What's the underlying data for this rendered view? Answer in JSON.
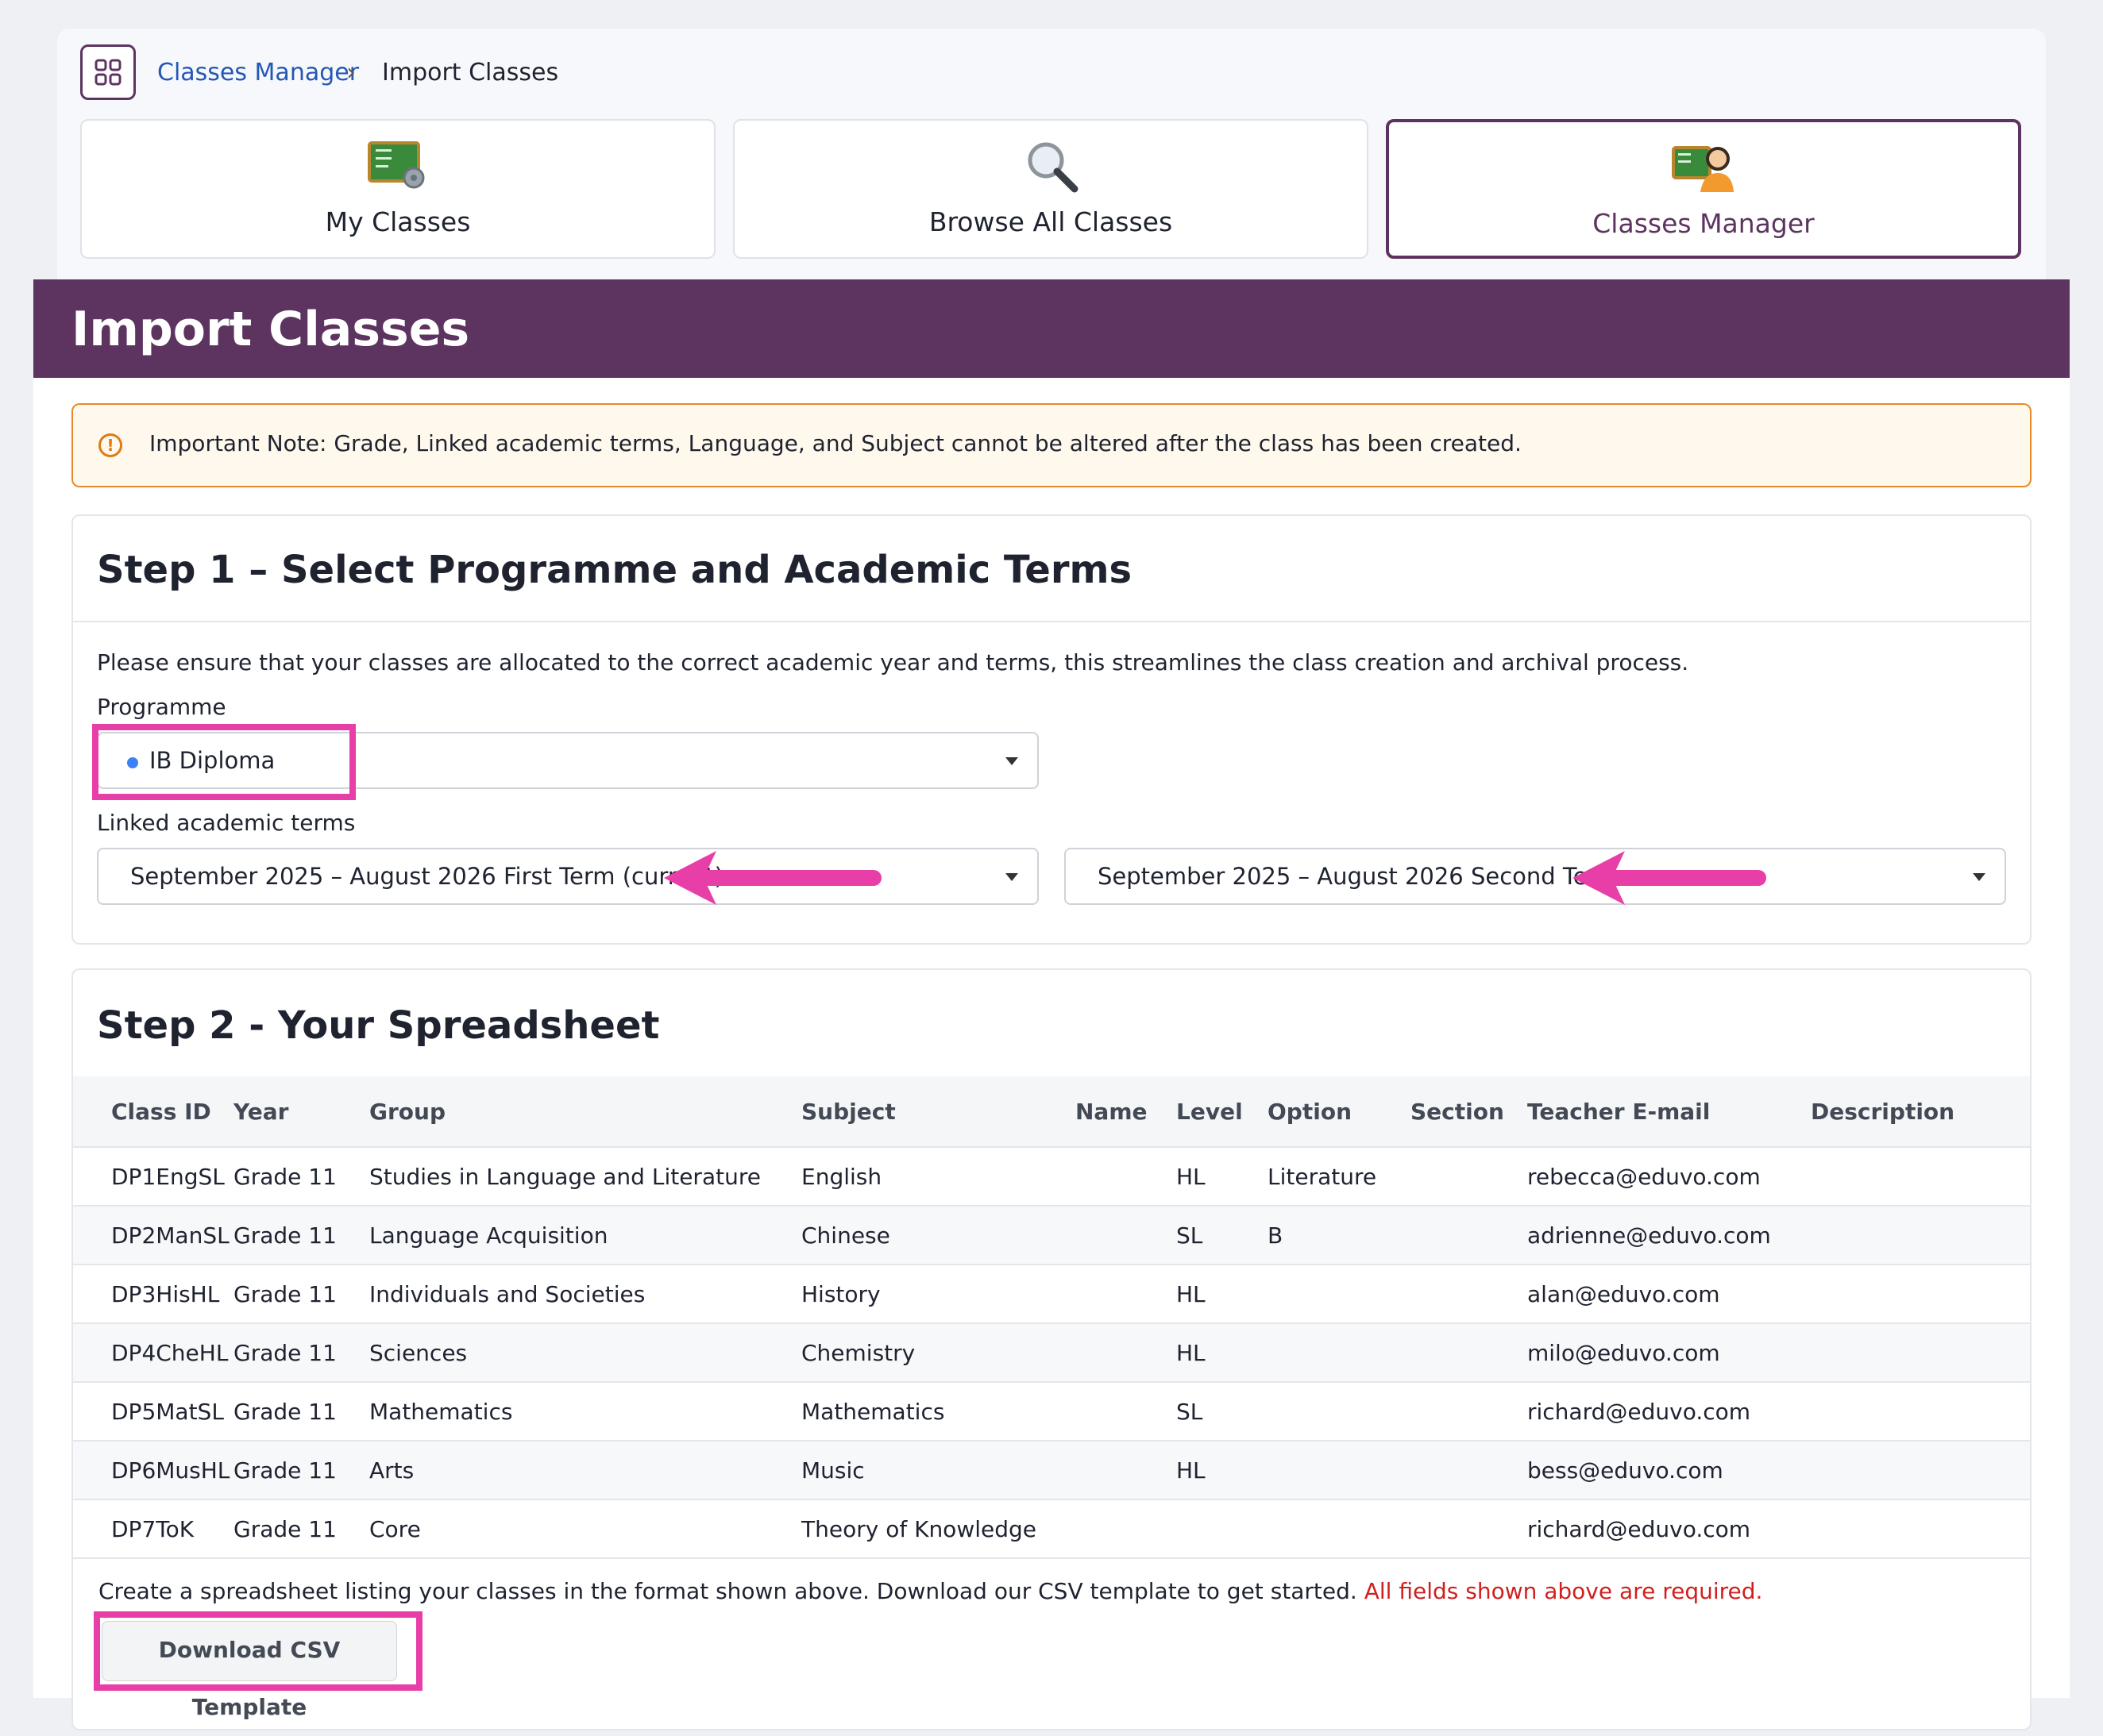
{
  "breadcrumb": {
    "parent": "Classes Manager",
    "separator": "›",
    "current": "Import Classes"
  },
  "tiles": [
    {
      "label": "My Classes",
      "icon": "classes-board-gear-icon"
    },
    {
      "label": "Browse All Classes",
      "icon": "magnifier-icon"
    },
    {
      "label": "Classes Manager",
      "icon": "classes-board-person-icon",
      "active": true
    }
  ],
  "page_title": "Import Classes",
  "note": {
    "icon": "alert-circle-icon",
    "text": "Important Note: Grade, Linked academic terms, Language, and Subject cannot be altered after the class has been created."
  },
  "step1": {
    "heading": "Step 1 – Select Programme and Academic Terms",
    "description": "Please ensure that your classes are allocated to the correct academic year and terms, this streamlines the class creation and archival process.",
    "programme_label": "Programme",
    "programme_value": "IB Diploma",
    "terms_label": "Linked academic terms",
    "term_first": "September 2025 – August 2026 First Term (current)",
    "term_second": "September 2025 – August 2026 Second Term"
  },
  "step2": {
    "heading": "Step 2 - Your Spreadsheet",
    "columns": [
      "Class ID",
      "Year",
      "Group",
      "Subject",
      "Name",
      "Level",
      "Option",
      "Section",
      "Teacher E-mail",
      "Description"
    ],
    "rows": [
      [
        "DP1EngSL",
        "Grade 11",
        "Studies in Language and Literature",
        "English",
        "",
        "HL",
        "Literature",
        "",
        "rebecca@eduvo.com",
        ""
      ],
      [
        "DP2ManSL",
        "Grade 11",
        "Language Acquisition",
        "Chinese",
        "",
        "SL",
        "B",
        "",
        "adrienne@eduvo.com",
        ""
      ],
      [
        "DP3HisHL",
        "Grade 11",
        "Individuals and Societies",
        "History",
        "",
        "HL",
        "",
        "",
        "alan@eduvo.com",
        ""
      ],
      [
        "DP4CheHL",
        "Grade 11",
        "Sciences",
        "Chemistry",
        "",
        "HL",
        "",
        "",
        "milo@eduvo.com",
        ""
      ],
      [
        "DP5MatSL",
        "Grade 11",
        "Mathematics",
        "Mathematics",
        "",
        "SL",
        "",
        "",
        "richard@eduvo.com",
        ""
      ],
      [
        "DP6MusHL",
        "Grade 11",
        "Arts",
        "Music",
        "",
        "HL",
        "",
        "",
        "bess@eduvo.com",
        ""
      ],
      [
        "DP7ToK",
        "Grade 11",
        "Core",
        "Theory of Knowledge",
        "",
        "",
        "",
        "",
        "richard@eduvo.com",
        ""
      ]
    ],
    "footer_text": "Create a spreadsheet listing your classes in the format shown above. Download our CSV template to get started.",
    "required_text": "All fields shown above are required.",
    "download_button": "Download CSV Template"
  },
  "colors": {
    "brand_purple": "#5d3460",
    "highlight_pink": "#e83ea8",
    "link_blue": "#2557b6",
    "warning_orange": "#e88a2a",
    "required_red": "#d11f1f"
  }
}
